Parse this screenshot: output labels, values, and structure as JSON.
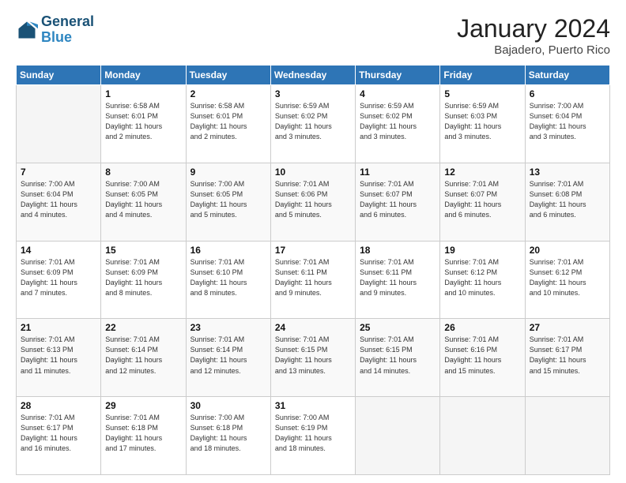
{
  "header": {
    "logo_line1": "General",
    "logo_line2": "Blue",
    "title": "January 2024",
    "subtitle": "Bajadero, Puerto Rico"
  },
  "weekdays": [
    "Sunday",
    "Monday",
    "Tuesday",
    "Wednesday",
    "Thursday",
    "Friday",
    "Saturday"
  ],
  "weeks": [
    [
      {
        "day": "",
        "info": ""
      },
      {
        "day": "1",
        "info": "Sunrise: 6:58 AM\nSunset: 6:01 PM\nDaylight: 11 hours\nand 2 minutes."
      },
      {
        "day": "2",
        "info": "Sunrise: 6:58 AM\nSunset: 6:01 PM\nDaylight: 11 hours\nand 2 minutes."
      },
      {
        "day": "3",
        "info": "Sunrise: 6:59 AM\nSunset: 6:02 PM\nDaylight: 11 hours\nand 3 minutes."
      },
      {
        "day": "4",
        "info": "Sunrise: 6:59 AM\nSunset: 6:02 PM\nDaylight: 11 hours\nand 3 minutes."
      },
      {
        "day": "5",
        "info": "Sunrise: 6:59 AM\nSunset: 6:03 PM\nDaylight: 11 hours\nand 3 minutes."
      },
      {
        "day": "6",
        "info": "Sunrise: 7:00 AM\nSunset: 6:04 PM\nDaylight: 11 hours\nand 3 minutes."
      }
    ],
    [
      {
        "day": "7",
        "info": "Sunrise: 7:00 AM\nSunset: 6:04 PM\nDaylight: 11 hours\nand 4 minutes."
      },
      {
        "day": "8",
        "info": "Sunrise: 7:00 AM\nSunset: 6:05 PM\nDaylight: 11 hours\nand 4 minutes."
      },
      {
        "day": "9",
        "info": "Sunrise: 7:00 AM\nSunset: 6:05 PM\nDaylight: 11 hours\nand 5 minutes."
      },
      {
        "day": "10",
        "info": "Sunrise: 7:01 AM\nSunset: 6:06 PM\nDaylight: 11 hours\nand 5 minutes."
      },
      {
        "day": "11",
        "info": "Sunrise: 7:01 AM\nSunset: 6:07 PM\nDaylight: 11 hours\nand 6 minutes."
      },
      {
        "day": "12",
        "info": "Sunrise: 7:01 AM\nSunset: 6:07 PM\nDaylight: 11 hours\nand 6 minutes."
      },
      {
        "day": "13",
        "info": "Sunrise: 7:01 AM\nSunset: 6:08 PM\nDaylight: 11 hours\nand 6 minutes."
      }
    ],
    [
      {
        "day": "14",
        "info": "Sunrise: 7:01 AM\nSunset: 6:09 PM\nDaylight: 11 hours\nand 7 minutes."
      },
      {
        "day": "15",
        "info": "Sunrise: 7:01 AM\nSunset: 6:09 PM\nDaylight: 11 hours\nand 8 minutes."
      },
      {
        "day": "16",
        "info": "Sunrise: 7:01 AM\nSunset: 6:10 PM\nDaylight: 11 hours\nand 8 minutes."
      },
      {
        "day": "17",
        "info": "Sunrise: 7:01 AM\nSunset: 6:11 PM\nDaylight: 11 hours\nand 9 minutes."
      },
      {
        "day": "18",
        "info": "Sunrise: 7:01 AM\nSunset: 6:11 PM\nDaylight: 11 hours\nand 9 minutes."
      },
      {
        "day": "19",
        "info": "Sunrise: 7:01 AM\nSunset: 6:12 PM\nDaylight: 11 hours\nand 10 minutes."
      },
      {
        "day": "20",
        "info": "Sunrise: 7:01 AM\nSunset: 6:12 PM\nDaylight: 11 hours\nand 10 minutes."
      }
    ],
    [
      {
        "day": "21",
        "info": "Sunrise: 7:01 AM\nSunset: 6:13 PM\nDaylight: 11 hours\nand 11 minutes."
      },
      {
        "day": "22",
        "info": "Sunrise: 7:01 AM\nSunset: 6:14 PM\nDaylight: 11 hours\nand 12 minutes."
      },
      {
        "day": "23",
        "info": "Sunrise: 7:01 AM\nSunset: 6:14 PM\nDaylight: 11 hours\nand 12 minutes."
      },
      {
        "day": "24",
        "info": "Sunrise: 7:01 AM\nSunset: 6:15 PM\nDaylight: 11 hours\nand 13 minutes."
      },
      {
        "day": "25",
        "info": "Sunrise: 7:01 AM\nSunset: 6:15 PM\nDaylight: 11 hours\nand 14 minutes."
      },
      {
        "day": "26",
        "info": "Sunrise: 7:01 AM\nSunset: 6:16 PM\nDaylight: 11 hours\nand 15 minutes."
      },
      {
        "day": "27",
        "info": "Sunrise: 7:01 AM\nSunset: 6:17 PM\nDaylight: 11 hours\nand 15 minutes."
      }
    ],
    [
      {
        "day": "28",
        "info": "Sunrise: 7:01 AM\nSunset: 6:17 PM\nDaylight: 11 hours\nand 16 minutes."
      },
      {
        "day": "29",
        "info": "Sunrise: 7:01 AM\nSunset: 6:18 PM\nDaylight: 11 hours\nand 17 minutes."
      },
      {
        "day": "30",
        "info": "Sunrise: 7:00 AM\nSunset: 6:18 PM\nDaylight: 11 hours\nand 18 minutes."
      },
      {
        "day": "31",
        "info": "Sunrise: 7:00 AM\nSunset: 6:19 PM\nDaylight: 11 hours\nand 18 minutes."
      },
      {
        "day": "",
        "info": ""
      },
      {
        "day": "",
        "info": ""
      },
      {
        "day": "",
        "info": ""
      }
    ]
  ]
}
